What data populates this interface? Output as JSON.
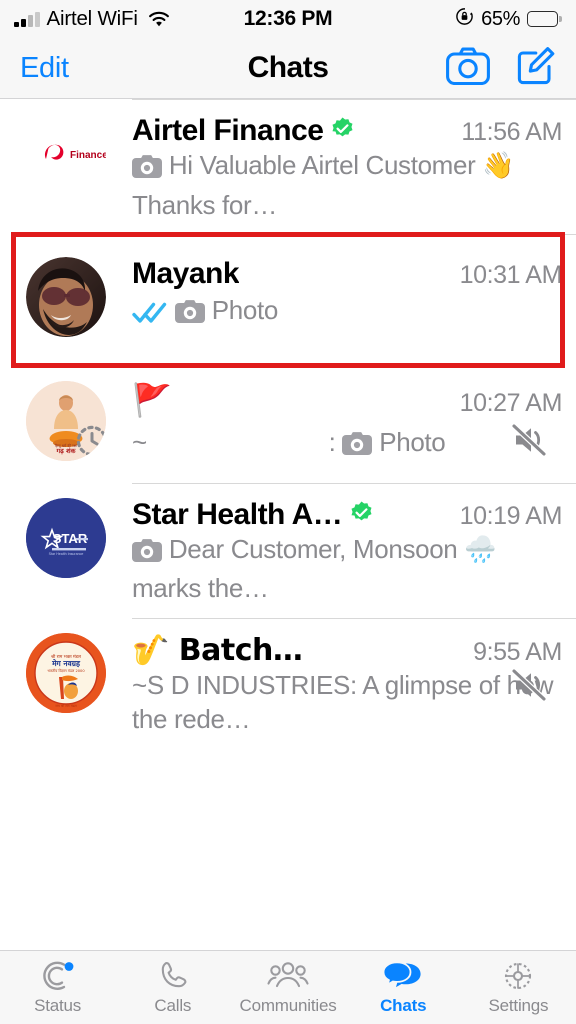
{
  "status_bar": {
    "carrier": "Airtel WiFi",
    "wifi_icon": "wifi-icon",
    "signal_icon": "cellular-signal-icon",
    "time": "12:36 PM",
    "rotation_lock_icon": "rotation-lock-icon",
    "battery_percent": "65%",
    "battery_level": 65,
    "battery_icon": "battery-icon"
  },
  "nav_bar": {
    "edit_label": "Edit",
    "title": "Chats",
    "camera_icon": "camera-icon",
    "compose_icon": "compose-icon"
  },
  "colors": {
    "accent_blue": "#0a84ff",
    "verified_green": "#25d366",
    "highlight_red": "#e01b1b",
    "secondary_text": "#8a8a8e",
    "chrome_background": "#f7f7f7"
  },
  "highlight": {
    "target": "chat-row-mayank",
    "color": "#e01b1b"
  },
  "chats": [
    {
      "name": "Airtel Finance",
      "verified": true,
      "time": "11:56 AM",
      "preview_prefix_icon": "camera-icon",
      "preview": "Hi Valuable Airtel Customer 👋 Thanks for…",
      "muted": false,
      "read_receipt": null,
      "avatar": {
        "type": "logo-airtel-finance",
        "label": "Finance",
        "background": "#ffffff"
      },
      "disappearing": false
    },
    {
      "name": "Mayank",
      "verified": false,
      "time": "10:31 AM",
      "preview_prefix_icon": "camera-icon",
      "preview": "Photo",
      "muted": false,
      "read_receipt": "read-double-check-icon",
      "avatar": {
        "type": "photo-portrait-sunglasses",
        "label": "",
        "background": "#2b1d18"
      },
      "disappearing": false
    },
    {
      "name": "🚩",
      "verified": false,
      "time": "10:27 AM",
      "preview_prefix_icon": "camera-icon",
      "preview_sender": "~",
      "preview": ": Photo",
      "muted": true,
      "read_receipt": null,
      "avatar": {
        "type": "photo-guru-shankar",
        "label": "गड़ शंक",
        "background": "#f6ded0"
      },
      "disappearing": true
    },
    {
      "name": "Star Health A…",
      "verified": true,
      "time": "10:19 AM",
      "preview_prefix_icon": "camera-icon",
      "preview": "Dear Customer, Monsoon 🌧️ marks the…",
      "muted": false,
      "read_receipt": null,
      "avatar": {
        "type": "logo-star-health",
        "label": "STAR",
        "background": "#2d3b91"
      },
      "disappearing": false
    },
    {
      "name": "🎷   Batch…",
      "verified": false,
      "time": "9:55 AM",
      "preview_prefix_icon": null,
      "preview": "~S D INDUSTRIES: A glimpse of how the rede…",
      "muted": true,
      "read_receipt": null,
      "avatar": {
        "type": "logo-mangal-navgrah",
        "label": "मेग नवग्रह",
        "background": "#e8541e"
      },
      "disappearing": false
    }
  ],
  "tab_bar": {
    "items": [
      {
        "label": "Status",
        "icon": "status-ring-icon",
        "active": false,
        "badge": true
      },
      {
        "label": "Calls",
        "icon": "phone-icon",
        "active": false,
        "badge": false
      },
      {
        "label": "Communities",
        "icon": "communities-icon",
        "active": false,
        "badge": false
      },
      {
        "label": "Chats",
        "icon": "chats-bubbles-icon",
        "active": true,
        "badge": false
      },
      {
        "label": "Settings",
        "icon": "gear-icon",
        "active": false,
        "badge": false
      }
    ]
  }
}
